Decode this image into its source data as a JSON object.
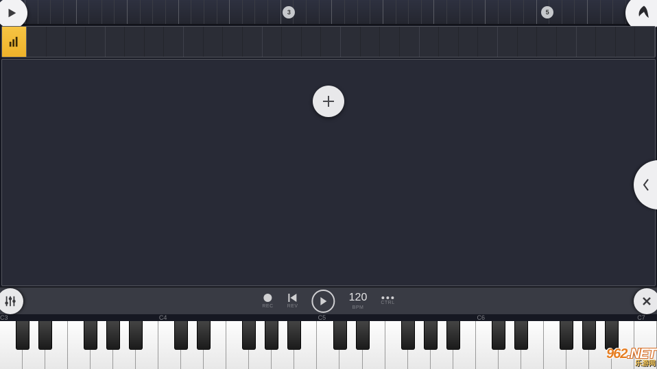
{
  "timeline": {
    "bar_markers": [
      {
        "value": "3",
        "pos_pct": 44.0
      },
      {
        "value": "5",
        "pos_pct": 87.0
      }
    ]
  },
  "transport": {
    "rec_label": "REC",
    "rev_label": "REV",
    "bpm_value": "120",
    "bpm_label": "BPM",
    "ctrl_label": "CTRL"
  },
  "keyboard": {
    "octave_labels": [
      {
        "label": "C3",
        "pos_pct": 0.0
      },
      {
        "label": "C4",
        "pos_pct": 24.2
      },
      {
        "label": "C5",
        "pos_pct": 48.4
      },
      {
        "label": "C6",
        "pos_pct": 72.6
      },
      {
        "label": "C7",
        "pos_pct": 97.0
      }
    ]
  },
  "watermark": {
    "line1_a": "962",
    "line1_b": ".NET",
    "line2": "乐游网"
  },
  "colors": {
    "accent": "#f6c443",
    "bg": "#282a36",
    "bg_dark": "#161822"
  }
}
